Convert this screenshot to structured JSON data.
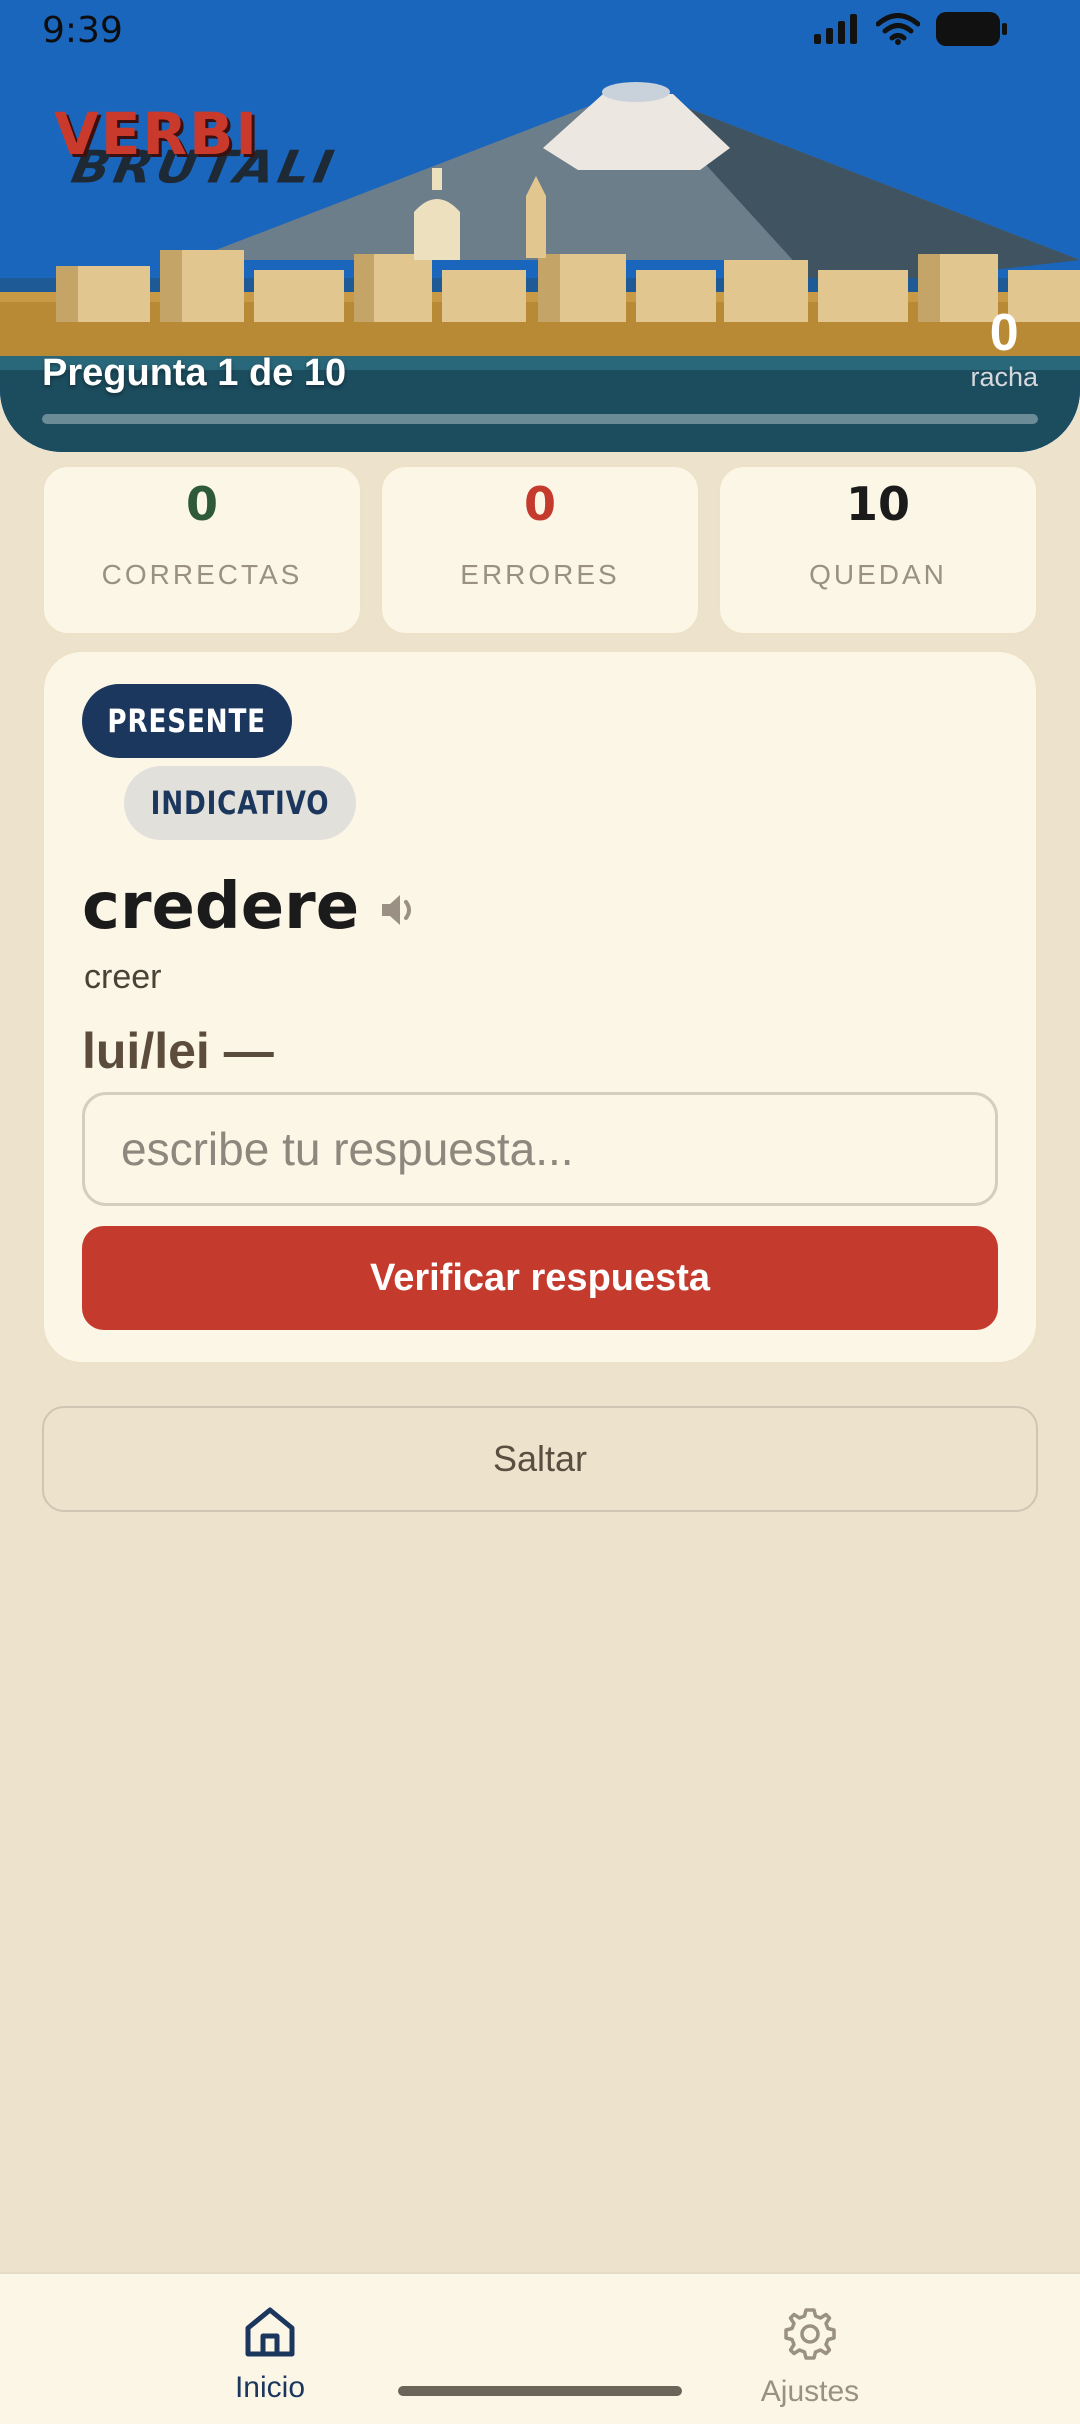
{
  "status_bar": {
    "time": "9:39"
  },
  "header": {
    "logo_main": "VERBI",
    "logo_sub": "BRUTALI",
    "question_label": "Pregunta 1 de 10",
    "streak_value": "0",
    "streak_label": "racha",
    "progress": 0.0
  },
  "stats": {
    "correct": {
      "value": "0",
      "label": "CORRECTAS",
      "color": "#2e5a3a"
    },
    "errors": {
      "value": "0",
      "label": "ERRORES",
      "color": "#c43a2d"
    },
    "remaining": {
      "value": "10",
      "label": "QUEDAN",
      "color": "#1b1b1b"
    }
  },
  "card": {
    "tense": "PRESENTE",
    "mood": "INDICATIVO",
    "verb": "credere",
    "translation": "creer",
    "pronoun": "lui/lei —",
    "input_placeholder": "escribe tu respuesta...",
    "verify_label": "Verificar respuesta"
  },
  "skip_label": "Saltar",
  "tabs": [
    {
      "label": "Inicio",
      "icon": "home-icon",
      "active": true
    },
    {
      "label": "Ajustes",
      "icon": "gear-icon",
      "active": false
    }
  ],
  "colors": {
    "accent": "#c43a2d",
    "navy": "#1c375e",
    "background": "#ede3cc",
    "card": "#fcf6e7"
  }
}
